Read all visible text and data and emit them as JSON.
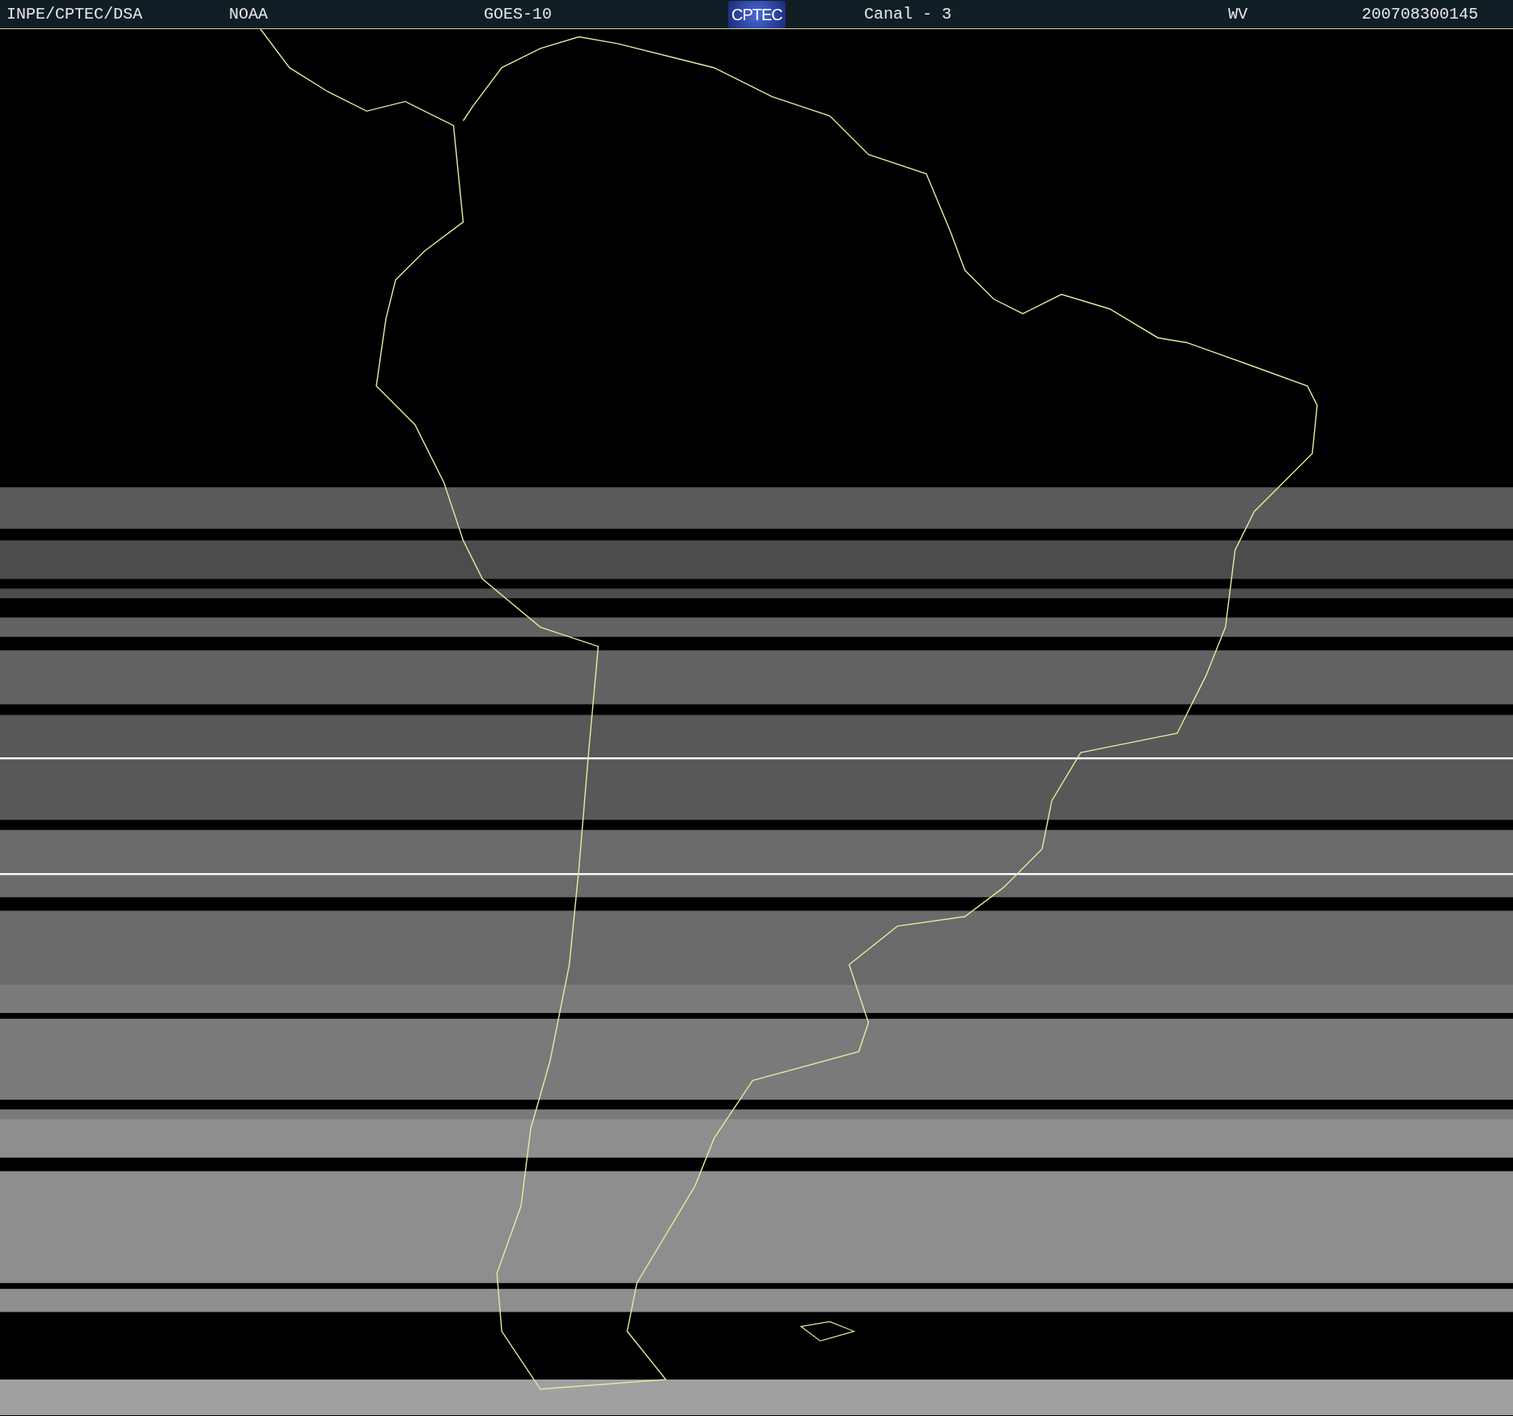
{
  "header": {
    "items": [
      {
        "kind": "text",
        "text": "INPE/CPTEC/DSA"
      },
      {
        "kind": "text",
        "text": "NOAA"
      },
      {
        "kind": "text",
        "text": "GOES-10"
      },
      {
        "kind": "logo",
        "text": "CPTEC"
      },
      {
        "kind": "text",
        "text": "Canal - 3"
      },
      {
        "kind": "text",
        "text": "WV"
      },
      {
        "kind": "text",
        "text": "200708300145"
      }
    ]
  }
}
